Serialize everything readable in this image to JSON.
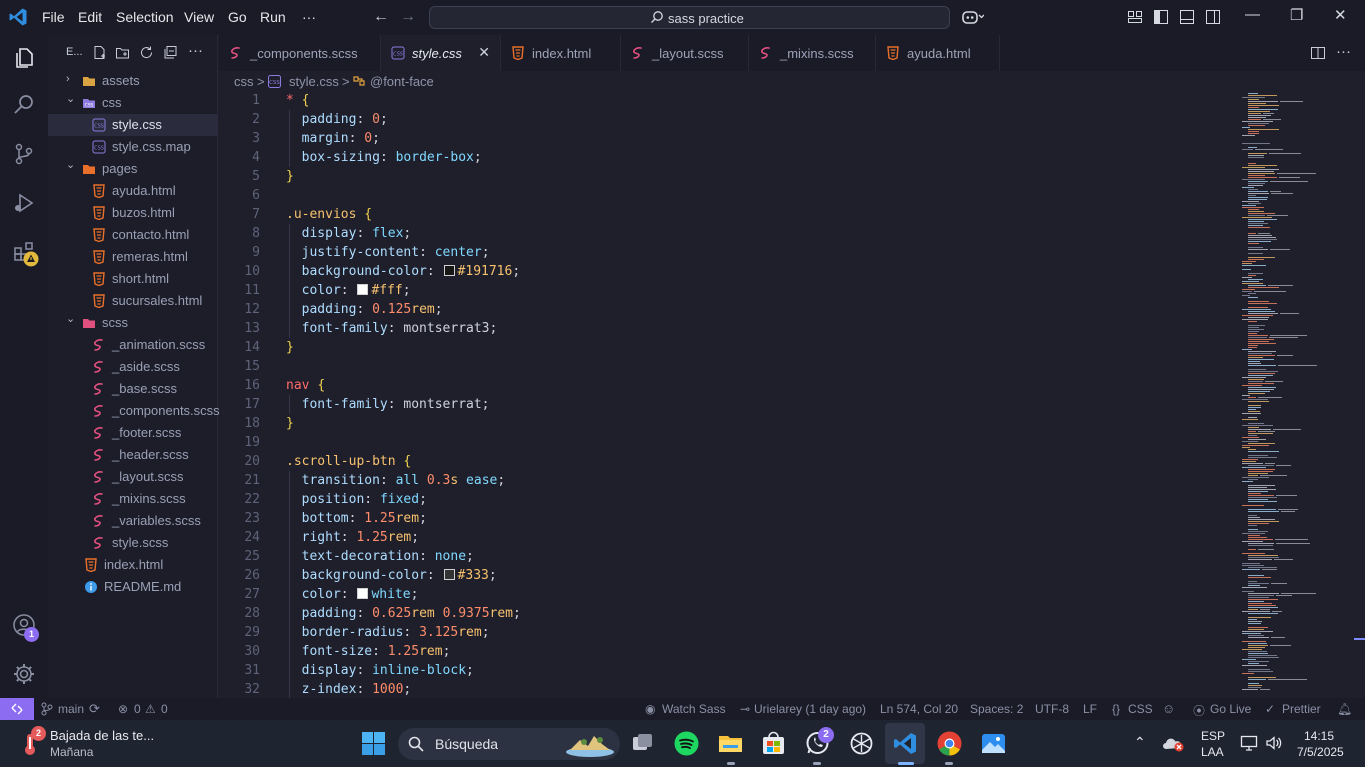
{
  "titlebar": {
    "menu": [
      "File",
      "Edit",
      "Selection",
      "View",
      "Go",
      "Run",
      "···"
    ],
    "search_text": "sass practice"
  },
  "activity": {
    "account_badge": "1"
  },
  "sidebar": {
    "header": "E...",
    "tree": [
      {
        "label": "assets",
        "kind": "folder",
        "depth": 0,
        "open": false,
        "icon": "folder-icon"
      },
      {
        "label": "css",
        "kind": "folder",
        "depth": 0,
        "open": true,
        "icon": "css-folder-icon"
      },
      {
        "label": "style.css",
        "kind": "css",
        "depth": 1,
        "selected": true,
        "icon": "css-file-icon"
      },
      {
        "label": "style.css.map",
        "kind": "css",
        "depth": 1,
        "icon": "css-file-icon"
      },
      {
        "label": "pages",
        "kind": "folder",
        "depth": 0,
        "open": true,
        "icon": "pages-folder-icon"
      },
      {
        "label": "ayuda.html",
        "kind": "html",
        "depth": 1,
        "icon": "html-file-icon"
      },
      {
        "label": "buzos.html",
        "kind": "html",
        "depth": 1,
        "icon": "html-file-icon"
      },
      {
        "label": "contacto.html",
        "kind": "html",
        "depth": 1,
        "icon": "html-file-icon"
      },
      {
        "label": "remeras.html",
        "kind": "html",
        "depth": 1,
        "icon": "html-file-icon"
      },
      {
        "label": "short.html",
        "kind": "html",
        "depth": 1,
        "icon": "html-file-icon"
      },
      {
        "label": "sucursales.html",
        "kind": "html",
        "depth": 1,
        "icon": "html-file-icon"
      },
      {
        "label": "scss",
        "kind": "folder",
        "depth": 0,
        "open": true,
        "icon": "scss-folder-icon"
      },
      {
        "label": "_animation.scss",
        "kind": "scss",
        "depth": 1,
        "icon": "sass-file-icon"
      },
      {
        "label": "_aside.scss",
        "kind": "scss",
        "depth": 1,
        "icon": "sass-file-icon"
      },
      {
        "label": "_base.scss",
        "kind": "scss",
        "depth": 1,
        "icon": "sass-file-icon"
      },
      {
        "label": "_components.scss",
        "kind": "scss",
        "depth": 1,
        "icon": "sass-file-icon"
      },
      {
        "label": "_footer.scss",
        "kind": "scss",
        "depth": 1,
        "icon": "sass-file-icon"
      },
      {
        "label": "_header.scss",
        "kind": "scss",
        "depth": 1,
        "icon": "sass-file-icon"
      },
      {
        "label": "_layout.scss",
        "kind": "scss",
        "depth": 1,
        "icon": "sass-file-icon"
      },
      {
        "label": "_mixins.scss",
        "kind": "scss",
        "depth": 1,
        "icon": "sass-file-icon"
      },
      {
        "label": "_variables.scss",
        "kind": "scss",
        "depth": 1,
        "icon": "sass-file-icon"
      },
      {
        "label": "style.scss",
        "kind": "scss",
        "depth": 1,
        "icon": "sass-file-icon"
      },
      {
        "label": "index.html",
        "kind": "html",
        "depth": 0,
        "icon": "html-file-icon"
      },
      {
        "label": "README.md",
        "kind": "info",
        "depth": 0,
        "icon": "info-icon"
      }
    ]
  },
  "tabs": [
    {
      "label": "_components.scss",
      "kind": "scss"
    },
    {
      "label": "style.css",
      "kind": "css",
      "active": true
    },
    {
      "label": "index.html",
      "kind": "html"
    },
    {
      "label": "_layout.scss",
      "kind": "scss"
    },
    {
      "label": "_mixins.scss",
      "kind": "scss"
    },
    {
      "label": "ayuda.html",
      "kind": "html"
    }
  ],
  "breadcrumb": {
    "folder": "css",
    "file": "style.css",
    "symbol": "@font-face",
    "sep1": ">",
    "sep2": ">"
  },
  "editor": {
    "lines": [
      [
        [
          "star",
          "*"
        ],
        [
          "t",
          " "
        ],
        [
          "brace",
          "{"
        ]
      ],
      [
        [
          "i",
          ""
        ],
        [
          "prop",
          "padding"
        ],
        [
          "t",
          ": "
        ],
        [
          "num",
          "0"
        ],
        [
          "t",
          ";"
        ]
      ],
      [
        [
          "i",
          ""
        ],
        [
          "prop",
          "margin"
        ],
        [
          "t",
          ": "
        ],
        [
          "num",
          "0"
        ],
        [
          "t",
          ";"
        ]
      ],
      [
        [
          "i",
          ""
        ],
        [
          "prop",
          "box-sizing"
        ],
        [
          "t",
          ": "
        ],
        [
          "kw",
          "border-box"
        ],
        [
          "t",
          ";"
        ]
      ],
      [
        [
          "brace",
          "}"
        ]
      ],
      [],
      [
        [
          "sel",
          ".u-envios"
        ],
        [
          "t",
          " "
        ],
        [
          "brace",
          "{"
        ]
      ],
      [
        [
          "i",
          ""
        ],
        [
          "prop",
          "display"
        ],
        [
          "t",
          ": "
        ],
        [
          "kw",
          "flex"
        ],
        [
          "t",
          ";"
        ]
      ],
      [
        [
          "i",
          ""
        ],
        [
          "prop",
          "justify-content"
        ],
        [
          "t",
          ": "
        ],
        [
          "kw",
          "center"
        ],
        [
          "t",
          ";"
        ]
      ],
      [
        [
          "i",
          ""
        ],
        [
          "prop",
          "background-color"
        ],
        [
          "t",
          ": "
        ],
        [
          "swatch",
          "#191716"
        ],
        [
          "sel",
          "#191716"
        ],
        [
          "t",
          ";"
        ]
      ],
      [
        [
          "i",
          ""
        ],
        [
          "prop",
          "color"
        ],
        [
          "t",
          ": "
        ],
        [
          "swatch",
          "#ffffff"
        ],
        [
          "sel",
          "#fff"
        ],
        [
          "t",
          ";"
        ]
      ],
      [
        [
          "i",
          ""
        ],
        [
          "prop",
          "padding"
        ],
        [
          "t",
          ": "
        ],
        [
          "num",
          "0.125"
        ],
        [
          "sel",
          "rem"
        ],
        [
          "t",
          ";"
        ]
      ],
      [
        [
          "i",
          ""
        ],
        [
          "prop",
          "font-family"
        ],
        [
          "t",
          ": montserrat3;"
        ]
      ],
      [
        [
          "brace",
          "}"
        ]
      ],
      [],
      [
        [
          "star",
          "nav"
        ],
        [
          "t",
          " "
        ],
        [
          "brace",
          "{"
        ]
      ],
      [
        [
          "i",
          ""
        ],
        [
          "prop",
          "font-family"
        ],
        [
          "t",
          ": montserrat;"
        ]
      ],
      [
        [
          "brace",
          "}"
        ]
      ],
      [],
      [
        [
          "sel",
          ".scroll-up-btn"
        ],
        [
          "t",
          " "
        ],
        [
          "brace",
          "{"
        ]
      ],
      [
        [
          "i",
          ""
        ],
        [
          "prop",
          "transition"
        ],
        [
          "t",
          ": "
        ],
        [
          "kw",
          "all"
        ],
        [
          "t",
          " "
        ],
        [
          "num",
          "0.3"
        ],
        [
          "sel",
          "s"
        ],
        [
          "t",
          " "
        ],
        [
          "kw",
          "ease"
        ],
        [
          "t",
          ";"
        ]
      ],
      [
        [
          "i",
          ""
        ],
        [
          "prop",
          "position"
        ],
        [
          "t",
          ": "
        ],
        [
          "kw",
          "fixed"
        ],
        [
          "t",
          ";"
        ]
      ],
      [
        [
          "i",
          ""
        ],
        [
          "prop",
          "bottom"
        ],
        [
          "t",
          ": "
        ],
        [
          "num",
          "1.25"
        ],
        [
          "sel",
          "rem"
        ],
        [
          "t",
          ";"
        ]
      ],
      [
        [
          "i",
          ""
        ],
        [
          "prop",
          "right"
        ],
        [
          "t",
          ": "
        ],
        [
          "num",
          "1.25"
        ],
        [
          "sel",
          "rem"
        ],
        [
          "t",
          ";"
        ]
      ],
      [
        [
          "i",
          ""
        ],
        [
          "prop",
          "text-decoration"
        ],
        [
          "t",
          ": "
        ],
        [
          "kw",
          "none"
        ],
        [
          "t",
          ";"
        ]
      ],
      [
        [
          "i",
          ""
        ],
        [
          "prop",
          "background-color"
        ],
        [
          "t",
          ": "
        ],
        [
          "swatch",
          "#333333"
        ],
        [
          "sel",
          "#333"
        ],
        [
          "t",
          ";"
        ]
      ],
      [
        [
          "i",
          ""
        ],
        [
          "prop",
          "color"
        ],
        [
          "t",
          ": "
        ],
        [
          "swatch",
          "#ffffff"
        ],
        [
          "kw",
          "white"
        ],
        [
          "t",
          ";"
        ]
      ],
      [
        [
          "i",
          ""
        ],
        [
          "prop",
          "padding"
        ],
        [
          "t",
          ": "
        ],
        [
          "num",
          "0.625"
        ],
        [
          "sel",
          "rem"
        ],
        [
          "t",
          " "
        ],
        [
          "num",
          "0.9375"
        ],
        [
          "sel",
          "rem"
        ],
        [
          "t",
          ";"
        ]
      ],
      [
        [
          "i",
          ""
        ],
        [
          "prop",
          "border-radius"
        ],
        [
          "t",
          ": "
        ],
        [
          "num",
          "3.125"
        ],
        [
          "sel",
          "rem"
        ],
        [
          "t",
          ";"
        ]
      ],
      [
        [
          "i",
          ""
        ],
        [
          "prop",
          "font-size"
        ],
        [
          "t",
          ": "
        ],
        [
          "num",
          "1.25"
        ],
        [
          "sel",
          "rem"
        ],
        [
          "t",
          ";"
        ]
      ],
      [
        [
          "i",
          ""
        ],
        [
          "prop",
          "display"
        ],
        [
          "t",
          ": "
        ],
        [
          "kw",
          "inline-block"
        ],
        [
          "t",
          ";"
        ]
      ],
      [
        [
          "i",
          ""
        ],
        [
          "prop",
          "z-index"
        ],
        [
          "t",
          ": "
        ],
        [
          "num",
          "1000"
        ],
        [
          "t",
          ";"
        ]
      ]
    ]
  },
  "statusbar": {
    "branch": "main",
    "errors": "0",
    "warnings": "0",
    "watch_sass": "Watch Sass",
    "blame": "Urielarey (1 day ago)",
    "position": "Ln 574, Col 20",
    "spaces": "Spaces: 2",
    "encoding": "UTF-8",
    "eol": "LF",
    "language": "CSS",
    "golive": "Go Live",
    "prettier": "Prettier"
  },
  "taskbar": {
    "weather_title": "Bajada de las te...",
    "weather_sub": "Mañana",
    "weather_badge": "2",
    "search_label": "Búsqueda",
    "whatsapp_badge": "2",
    "lang": "ESP",
    "lang_sub": "LAA",
    "time": "14:15",
    "date": "7/5/2025"
  },
  "colors": {
    "accent": "#8c6cf0",
    "sass": "#e0507f",
    "html": "#e8702a",
    "css": "#8f7be0",
    "folder": "#d9a441"
  }
}
